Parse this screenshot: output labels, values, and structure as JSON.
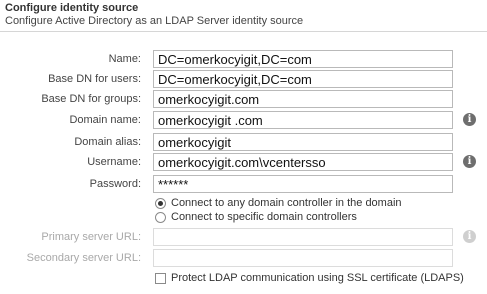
{
  "header": {
    "title": "Configure identity source",
    "subtitle": "Configure Active Directory as an LDAP Server identity source"
  },
  "form": {
    "name": {
      "label": "Name:",
      "value": "DC=omerkocyigit,DC=com"
    },
    "base_dn_users": {
      "label": "Base DN for users:",
      "value": "DC=omerkocyigit,DC=com"
    },
    "base_dn_groups": {
      "label": "Base DN for groups:",
      "value": "omerkocyigit.com"
    },
    "domain_name": {
      "label": "Domain name:",
      "value": "omerkocyigit .com"
    },
    "domain_alias": {
      "label": "Domain alias:",
      "value": "omerkocyigit"
    },
    "username": {
      "label": "Username:",
      "value": "omerkocyigit.com\\vcentersso"
    },
    "password": {
      "label": "Password:",
      "value": "******"
    },
    "connect_options": [
      {
        "label": "Connect to any domain controller in the domain",
        "selected": true
      },
      {
        "label": "Connect to specific domain controllers",
        "selected": false
      }
    ],
    "primary_server_url": {
      "label": "Primary server URL:",
      "value": ""
    },
    "secondary_server_url": {
      "label": "Secondary server URL:",
      "value": ""
    },
    "ssl_protect": {
      "label": "Protect LDAP communication using SSL certificate (LDAPS)",
      "checked": false
    }
  },
  "icons": {
    "info": "info-icon"
  },
  "colors": {
    "border": "#b9b9b9",
    "disabled_text": "#a9a9a9",
    "info_icon": "#6e6e6e"
  }
}
